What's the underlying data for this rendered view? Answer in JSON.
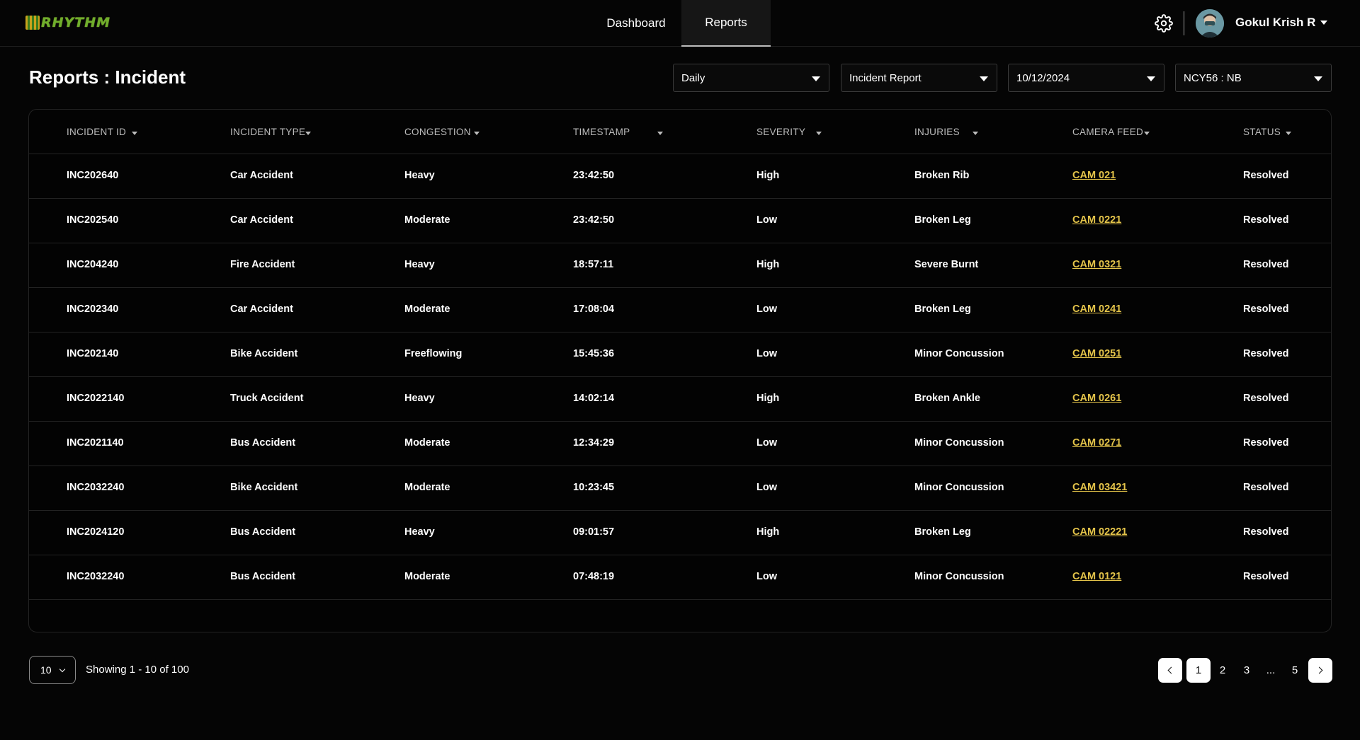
{
  "header": {
    "logo_text": "RHYTHM",
    "nav": [
      {
        "label": "Dashboard"
      },
      {
        "label": "Reports"
      }
    ],
    "user_name": "Gokul Krish R"
  },
  "page": {
    "title": "Reports : Incident",
    "filters": {
      "period": "Daily",
      "report_type": "Incident Report",
      "date": "10/12/2024",
      "location": "NCY56 : NB"
    }
  },
  "table": {
    "columns": [
      "INCIDENT  ID",
      "INCIDENT TYPE",
      "CONGESTION",
      "TIMESTAMP",
      "SEVERITY",
      "INJURIES",
      "CAMERA FEED",
      "STATUS"
    ],
    "rows": [
      {
        "id": "INC202640",
        "type": "Car Accident",
        "congestion": "Heavy",
        "timestamp": "23:42:50",
        "severity": "High",
        "injuries": "Broken Rib",
        "camera": "CAM 021",
        "status": "Resolved"
      },
      {
        "id": "INC202540",
        "type": "Car Accident",
        "congestion": "Moderate",
        "timestamp": "23:42:50",
        "severity": "Low",
        "injuries": "Broken Leg",
        "camera": "CAM 0221",
        "status": "Resolved"
      },
      {
        "id": "INC204240",
        "type": "Fire Accident",
        "congestion": "Heavy",
        "timestamp": "18:57:11",
        "severity": "High",
        "injuries": "Severe Burnt",
        "camera": "CAM 0321",
        "status": "Resolved"
      },
      {
        "id": "INC202340",
        "type": "Car Accident",
        "congestion": "Moderate",
        "timestamp": "17:08:04",
        "severity": "Low",
        "injuries": "Broken Leg",
        "camera": "CAM 0241",
        "status": "Resolved"
      },
      {
        "id": "INC202140",
        "type": "Bike Accident",
        "congestion": "Freeflowing",
        "timestamp": "15:45:36",
        "severity": "Low",
        "injuries": "Minor Concussion",
        "camera": "CAM 0251",
        "status": "Resolved"
      },
      {
        "id": "INC2022140",
        "type": "Truck Accident",
        "congestion": "Heavy",
        "timestamp": "14:02:14",
        "severity": "High",
        "injuries": "Broken Ankle",
        "camera": "CAM 0261",
        "status": "Resolved"
      },
      {
        "id": "INC2021140",
        "type": "Bus Accident",
        "congestion": "Moderate",
        "timestamp": "12:34:29",
        "severity": "Low",
        "injuries": "Minor Concussion",
        "camera": "CAM 0271",
        "status": "Resolved"
      },
      {
        "id": "INC2032240",
        "type": "Bike Accident",
        "congestion": "Moderate",
        "timestamp": "10:23:45",
        "severity": "Low",
        "injuries": "Minor Concussion",
        "camera": "CAM 03421",
        "status": "Resolved"
      },
      {
        "id": "INC2024120",
        "type": "Bus Accident",
        "congestion": "Heavy",
        "timestamp": "09:01:57",
        "severity": "High",
        "injuries": "Broken Leg",
        "camera": "CAM 02221",
        "status": "Resolved"
      },
      {
        "id": "INC2032240",
        "type": "Bus Accident",
        "congestion": "Moderate",
        "timestamp": "07:48:19",
        "severity": "Low",
        "injuries": "Minor Concussion",
        "camera": "CAM 0121",
        "status": "Resolved"
      }
    ]
  },
  "footer": {
    "per_page": "10",
    "showing": "Showing 1 - 10 of 100",
    "pages": [
      "1",
      "2",
      "3",
      "...",
      "5"
    ],
    "active_page": "1"
  },
  "icons": {
    "settings": "gear-icon",
    "user_menu": "caret-down-icon",
    "prev": "chevron-left-icon",
    "next": "chevron-right-icon"
  },
  "colors": {
    "background": "#050505",
    "camera_link": "#e4c44a",
    "border": "#232323"
  }
}
